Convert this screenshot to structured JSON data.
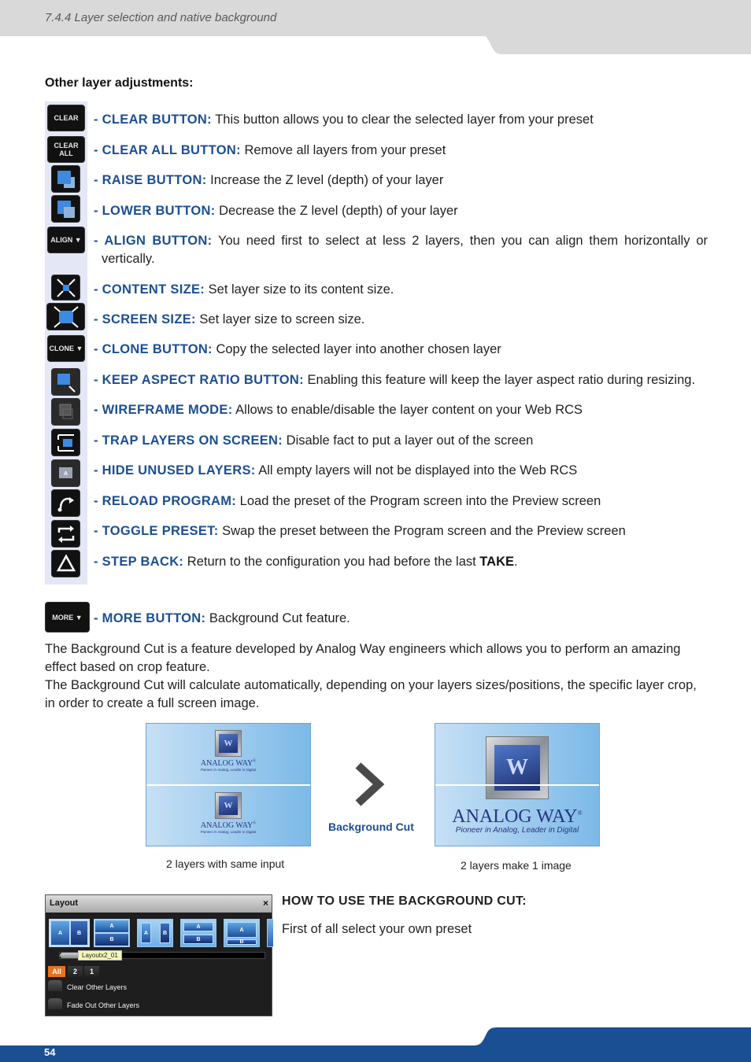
{
  "header": {
    "section_title": "7.4.4 Layer selection and native background"
  },
  "footer": {
    "page_number": "54",
    "accent_color": "#1a4f93"
  },
  "heading": "Other layer adjustments:",
  "items": [
    {
      "icon": "clear-icon",
      "icon_text": "CLEAR",
      "label": "- CLEAR BUTTON:",
      "text": " This button allows you to clear the selected layer from your preset"
    },
    {
      "icon": "clear-all-icon",
      "icon_text": "CLEAR ALL",
      "label": "- CLEAR ALL BUTTON:",
      "text": " Remove all layers from your preset"
    },
    {
      "icon": "raise-icon",
      "icon_text": "",
      "label": "- RAISE BUTTON:",
      "text": " Increase the Z level (depth) of your layer"
    },
    {
      "icon": "lower-icon",
      "icon_text": "",
      "label": "- LOWER BUTTON:",
      "text": " Decrease the Z level (depth) of your layer"
    },
    {
      "icon": "align-icon",
      "icon_text": "ALIGN ▼",
      "label": "- ALIGN BUTTON:",
      "text": " You need first to select at less 2 layers, then you can align them horizontally or vertically."
    },
    {
      "icon": "content-size-icon",
      "icon_text": "",
      "label": "- CONTENT SIZE:",
      "text": " Set layer size to its content size."
    },
    {
      "icon": "screen-size-icon",
      "icon_text": "",
      "label": "- SCREEN SIZE:",
      "text": " Set layer size to screen size."
    },
    {
      "icon": "clone-icon",
      "icon_text": "CLONE ▼",
      "label": "- CLONE BUTTON:",
      "text": " Copy the selected layer into another chosen layer"
    },
    {
      "icon": "keep-aspect-ratio-icon",
      "icon_text": "",
      "label": "- KEEP ASPECT RATIO BUTTON:",
      "text": " Enabling this feature will keep the layer aspect ratio during resizing."
    },
    {
      "icon": "wireframe-icon",
      "icon_text": "",
      "label": "- WIREFRAME MODE:",
      "text": " Allows to enable/disable the layer content on your Web RCS"
    },
    {
      "icon": "trap-layers-icon",
      "icon_text": "",
      "label": "- TRAP LAYERS ON SCREEN:",
      "text": " Disable fact to put a layer out of the screen"
    },
    {
      "icon": "hide-unused-icon",
      "icon_text": "",
      "label": "- HIDE UNUSED LAYERS:",
      "text": " All empty layers will not be displayed into the Web RCS"
    },
    {
      "icon": "reload-program-icon",
      "icon_text": "",
      "label": "- RELOAD PROGRAM:",
      "text": " Load the preset of the Program screen into the Preview screen"
    },
    {
      "icon": "toggle-preset-icon",
      "icon_text": "",
      "label": "- TOGGLE PRESET:",
      "text": " Swap the preset between the Program screen and the Preview screen"
    },
    {
      "icon": "step-back-icon",
      "icon_text": "",
      "label": "- STEP BACK:",
      "text": " Return to the configuration you had before the last ",
      "bold_tail": "TAKE",
      "tail": "."
    }
  ],
  "more": {
    "icon": "more-icon",
    "icon_text": "MORE ▼",
    "label": "- MORE BUTTON:",
    "text": " Background Cut feature."
  },
  "paragraphs": [
    "The Background Cut is a feature developed by Analog Way engineers which allows you to perform an amazing effect based on crop feature.",
    "The Background Cut will calculate automatically, depending on your layers sizes/positions, the specific layer crop, in order to create a full screen image."
  ],
  "figure": {
    "logo_text": "ANALOG WAY",
    "logo_reg": "®",
    "logo_tagline": "Pioneer in Analog, Leader in Digital",
    "arrow_label": "Background Cut",
    "left_caption": "2 layers with same input",
    "right_caption": "2 layers make 1 image"
  },
  "layout_dialog": {
    "title": "Layout",
    "close": "×",
    "tooltip": "Layoutx2_01",
    "thumbs": [
      {
        "a": "A",
        "b": "B"
      },
      {
        "a": "A",
        "b": "B"
      },
      {
        "a": "A",
        "b": "B"
      },
      {
        "a": "A",
        "b": "B"
      },
      {
        "a": "A",
        "b": "B"
      },
      {
        "a": "",
        "b": ""
      }
    ],
    "filters": [
      "All",
      "2",
      "1"
    ],
    "options": [
      "Clear Other Layers",
      "Fade Out Other Layers"
    ]
  },
  "how_to": {
    "heading": "HOW TO USE THE BACKGROUND CUT:",
    "text": "First of all select your own preset"
  }
}
